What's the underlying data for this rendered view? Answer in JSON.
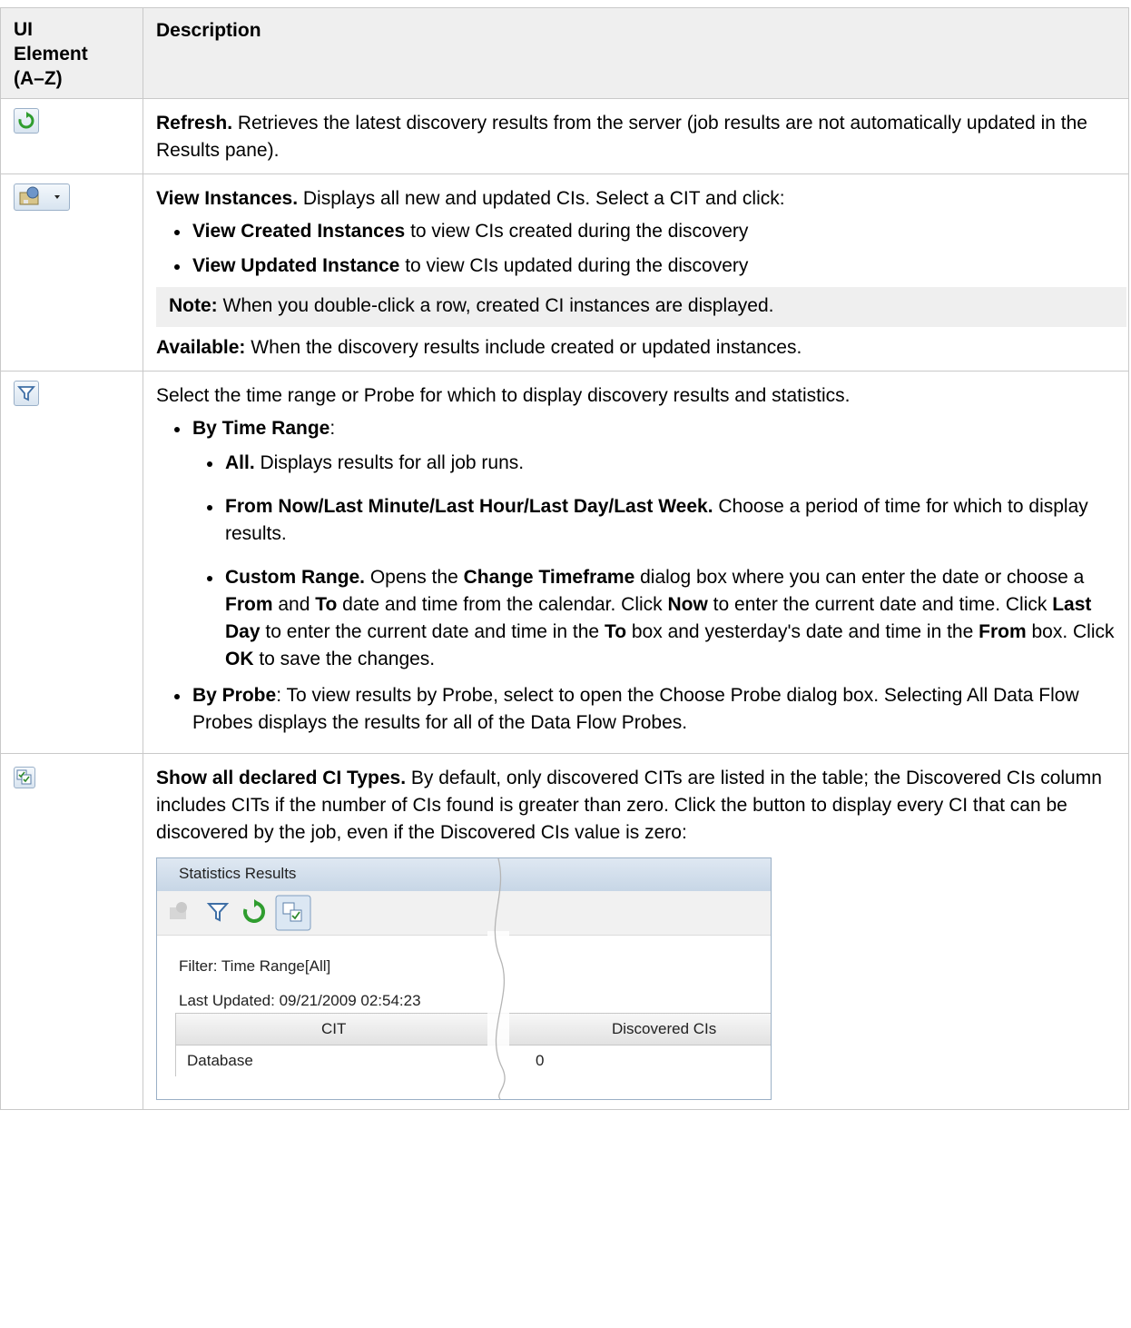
{
  "headers": {
    "col1": "UI Element (A–Z)",
    "col2": "Description"
  },
  "refresh": {
    "icon": "refresh-icon",
    "title": "Refresh.",
    "text": " Retrieves the latest discovery results from the server (job results are not automatically updated in the Results pane)."
  },
  "view_instances": {
    "icon": "view-instances-icon",
    "title": "View Instances.",
    "text": " Displays all new and updated CIs. Select a CIT and click:",
    "items": [
      {
        "bold": "View Created Instances",
        "text": " to view CIs created during the discovery"
      },
      {
        "bold": "View Updated Instance",
        "text": " to view CIs updated during the discovery"
      }
    ],
    "note_label": "Note:",
    "note_text": " When you double-click a row, created CI instances are displayed.",
    "available_label": "Available:",
    "available_text": " When the discovery results include created or updated instances."
  },
  "filter": {
    "icon": "filter-icon",
    "intro": "Select the time range or Probe for which to display discovery results and statistics.",
    "by_time_label": "By Time Range",
    "by_time_suffix": ":",
    "all_label": "All.",
    "all_text": " Displays results for all job runs.",
    "from_label": "From Now/Last Minute/Last Hour/Last Day/Last Week.",
    "from_text": " Choose a period of time for which to display results.",
    "custom_label": "Custom Range.",
    "custom_t1": " Opens the ",
    "custom_b1": "Change Timeframe",
    "custom_t2": " dialog box where you can enter the date or choose a ",
    "custom_b2": "From",
    "custom_t3": " and ",
    "custom_b3": "To",
    "custom_t4": " date and time from the calendar. Click ",
    "custom_b4": "Now",
    "custom_t5": " to enter the current date and time. Click ",
    "custom_b5": "Last Day",
    "custom_t6": " to enter the current date and time in the ",
    "custom_b6": "To",
    "custom_t7": " box and yesterday's date and time in the ",
    "custom_b7": "From",
    "custom_t8": " box. Click ",
    "custom_b8": "OK",
    "custom_t9": " to save the changes.",
    "probe_label": "By Probe",
    "probe_text": ": To view results by Probe, select to open the Choose Probe dialog box. Selecting All Data Flow Probes displays the results for all of the Data Flow Probes."
  },
  "show_all": {
    "icon": "show-all-types-icon",
    "title": "Show all declared CI Types.",
    "text": " By default, only discovered CITs are listed in the table; the Discovered CIs column includes CITs if the number of CIs found is greater than zero. Click the button to display every CI that can be discovered by the job, even if the Discovered CIs value is zero:"
  },
  "screenshot": {
    "panel_title": "Statistics Results",
    "filter_line": "Filter: Time Range[All]",
    "updated_line": "Last Updated: 09/21/2009 02:54:23",
    "col_cit": "CIT",
    "col_discovered": "Discovered CIs",
    "row_name": "Database",
    "row_value": "0"
  }
}
